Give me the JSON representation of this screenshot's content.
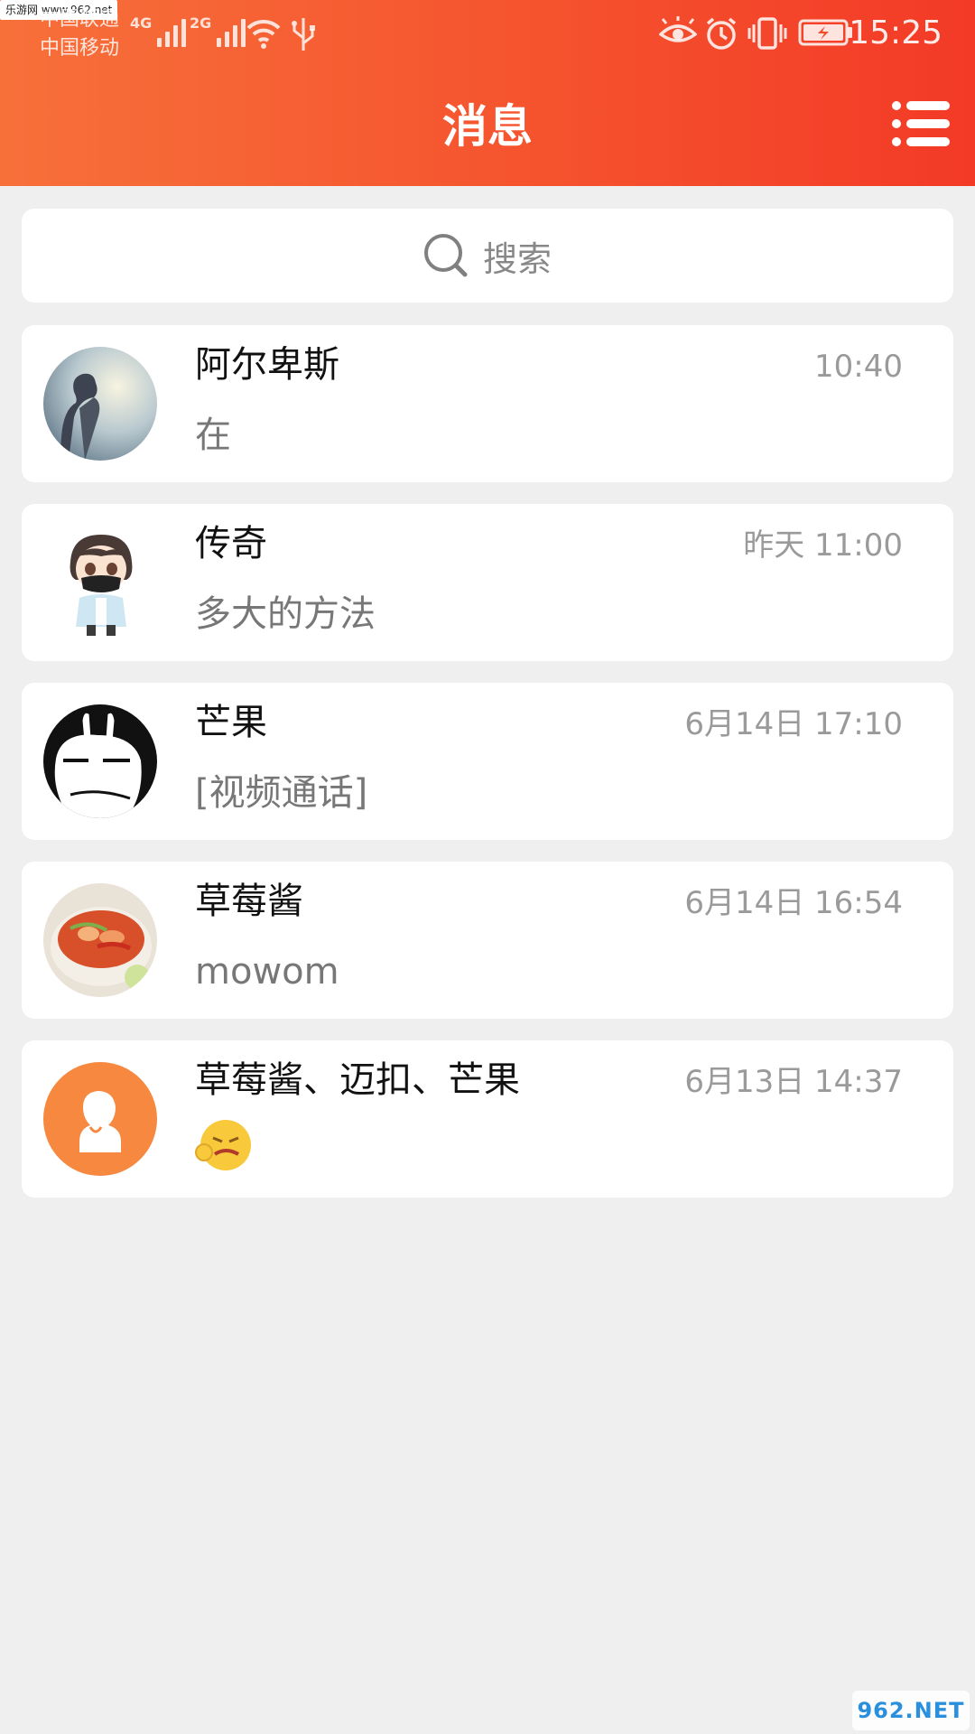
{
  "status_bar": {
    "watermark": "乐游网 www.962.net",
    "carrier_1": "中国联通",
    "carrier_2": "中国移动",
    "network_1": "4G",
    "network_2": "2G",
    "time": "15:25"
  },
  "header": {
    "title": "消息",
    "background_colors": [
      "#f7703a",
      "#f33a27"
    ]
  },
  "search": {
    "placeholder": "搜索"
  },
  "conversations": [
    {
      "name": "阿尔卑斯",
      "time": "10:40",
      "preview": "在",
      "avatar": "photo-avatar"
    },
    {
      "name": "传奇",
      "time": "昨天 11:00",
      "preview": "多大的方法",
      "avatar": "anime-avatar"
    },
    {
      "name": "芒果",
      "time": "6月14日 17:10",
      "preview": "[视频通话]",
      "avatar": "rabbit-avatar"
    },
    {
      "name": "草莓酱",
      "time": "6月14日 16:54",
      "preview": "mowom",
      "avatar": "food-avatar"
    },
    {
      "name": "草莓酱、迈扣、芒果",
      "time": "6月13日 14:37",
      "preview_emoji": "grimace-emoji",
      "avatar": "group-avatar"
    }
  ],
  "footer_watermark": "962.NET"
}
